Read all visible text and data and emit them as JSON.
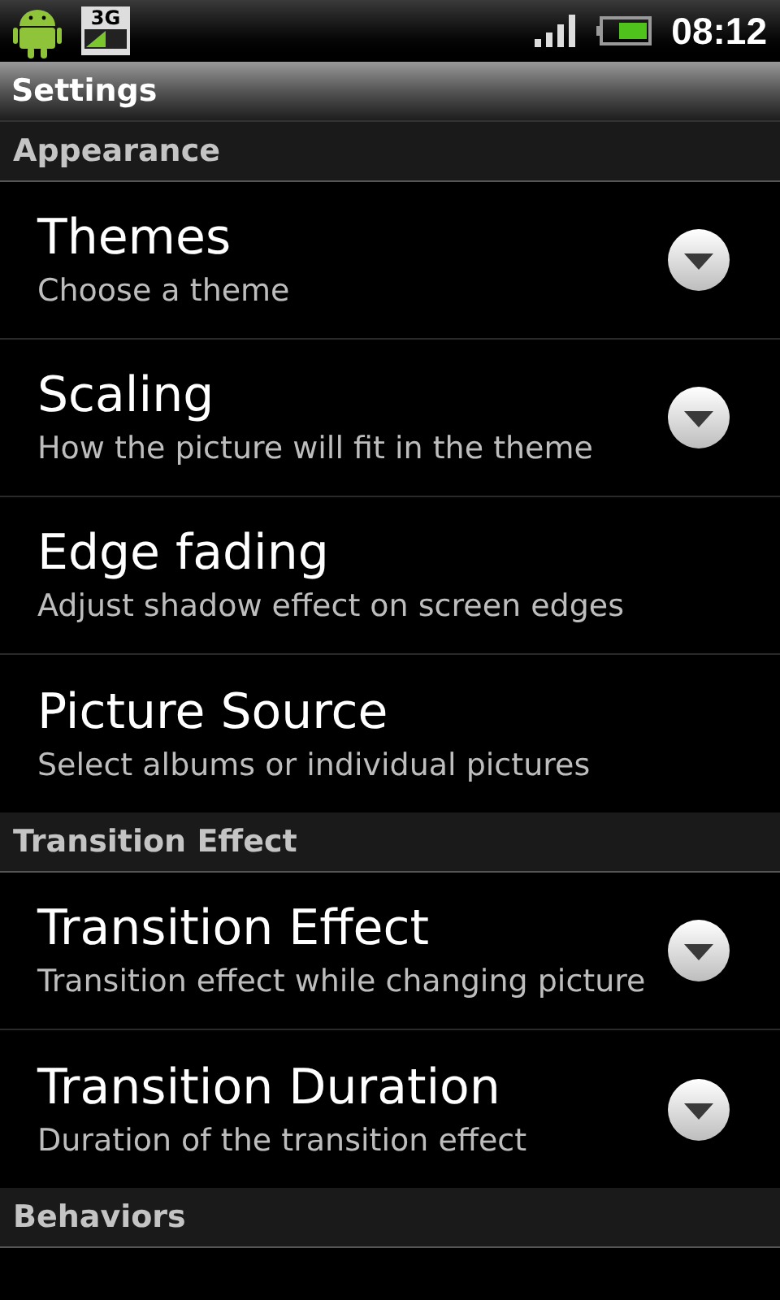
{
  "status_bar": {
    "time": "08:12",
    "network": "3G"
  },
  "title": "Settings",
  "sections": [
    {
      "header": "Appearance",
      "items": [
        {
          "title": "Themes",
          "summary": "Choose a theme",
          "kind": "list"
        },
        {
          "title": "Scaling",
          "summary": "How the picture will fit in the theme",
          "kind": "list"
        },
        {
          "title": "Edge fading",
          "summary": "Adjust shadow effect on screen edges",
          "kind": "plain"
        },
        {
          "title": "Picture Source",
          "summary": "Select albums or individual pictures",
          "kind": "plain"
        }
      ]
    },
    {
      "header": "Transition Effect",
      "items": [
        {
          "title": "Transition Effect",
          "summary": "Transition effect while changing picture",
          "kind": "list"
        },
        {
          "title": "Transition Duration",
          "summary": "Duration of the transition effect",
          "kind": "list"
        }
      ]
    },
    {
      "header": "Behaviors"
    }
  ]
}
